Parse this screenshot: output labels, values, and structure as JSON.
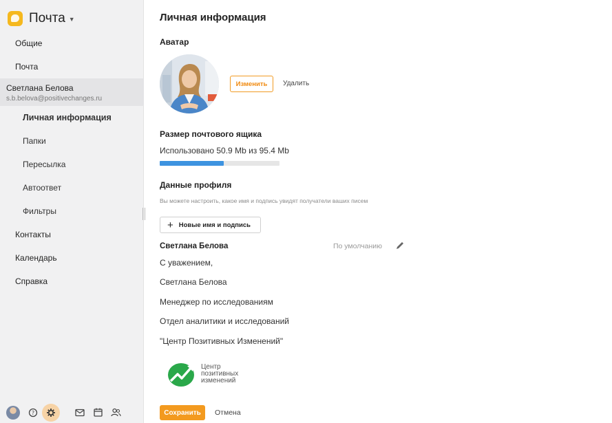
{
  "sidebar": {
    "app_title": "Почта",
    "nav": [
      {
        "label": "Общие"
      },
      {
        "label": "Почта"
      }
    ],
    "account": {
      "name": "Светлана Белова",
      "email": "s.b.belova@positivechanges.ru"
    },
    "sub_nav": [
      {
        "label": "Личная информация",
        "active": true
      },
      {
        "label": "Папки"
      },
      {
        "label": "Пересылка"
      },
      {
        "label": "Автоответ"
      },
      {
        "label": "Фильтры"
      }
    ],
    "bottom_nav": [
      {
        "label": "Контакты"
      },
      {
        "label": "Календарь"
      },
      {
        "label": "Справка"
      }
    ],
    "footer_icons": [
      "user-avatar-icon",
      "help-icon",
      "settings-icon",
      "mail-icon",
      "calendar-icon",
      "contacts-icon"
    ]
  },
  "main": {
    "title": "Личная информация",
    "avatar": {
      "section_title": "Аватар",
      "change_label": "Изменить",
      "delete_label": "Удалить"
    },
    "mailbox": {
      "section_title": "Размер почтового ящика",
      "usage_text": "Использовано 50.9 Mb из 95.4 Mb",
      "used_fraction": 0.534
    },
    "profile": {
      "section_title": "Данные профиля",
      "hint": "Вы можете настроить, какое имя и подпись увидят получатели ваших писем",
      "new_button_label": "Новые имя и подпись",
      "signature": {
        "name": "Светлана Белова",
        "default_label": "По умолчанию",
        "lines": [
          "С уважением,",
          "Светлана Белова",
          "Менеджер по исследованиям",
          "Отдел аналитики и исследований",
          "\"Центр Позитивных Изменений\""
        ],
        "logo_text": [
          "Центр",
          "позитивных",
          "изменений"
        ]
      }
    },
    "save_label": "Сохранить",
    "cancel_label": "Отмена"
  },
  "colors": {
    "accent": "#f39a1f",
    "progress": "#3d93e0",
    "logo_yellow": "#f5b81e",
    "logo_green": "#2aa84a"
  }
}
